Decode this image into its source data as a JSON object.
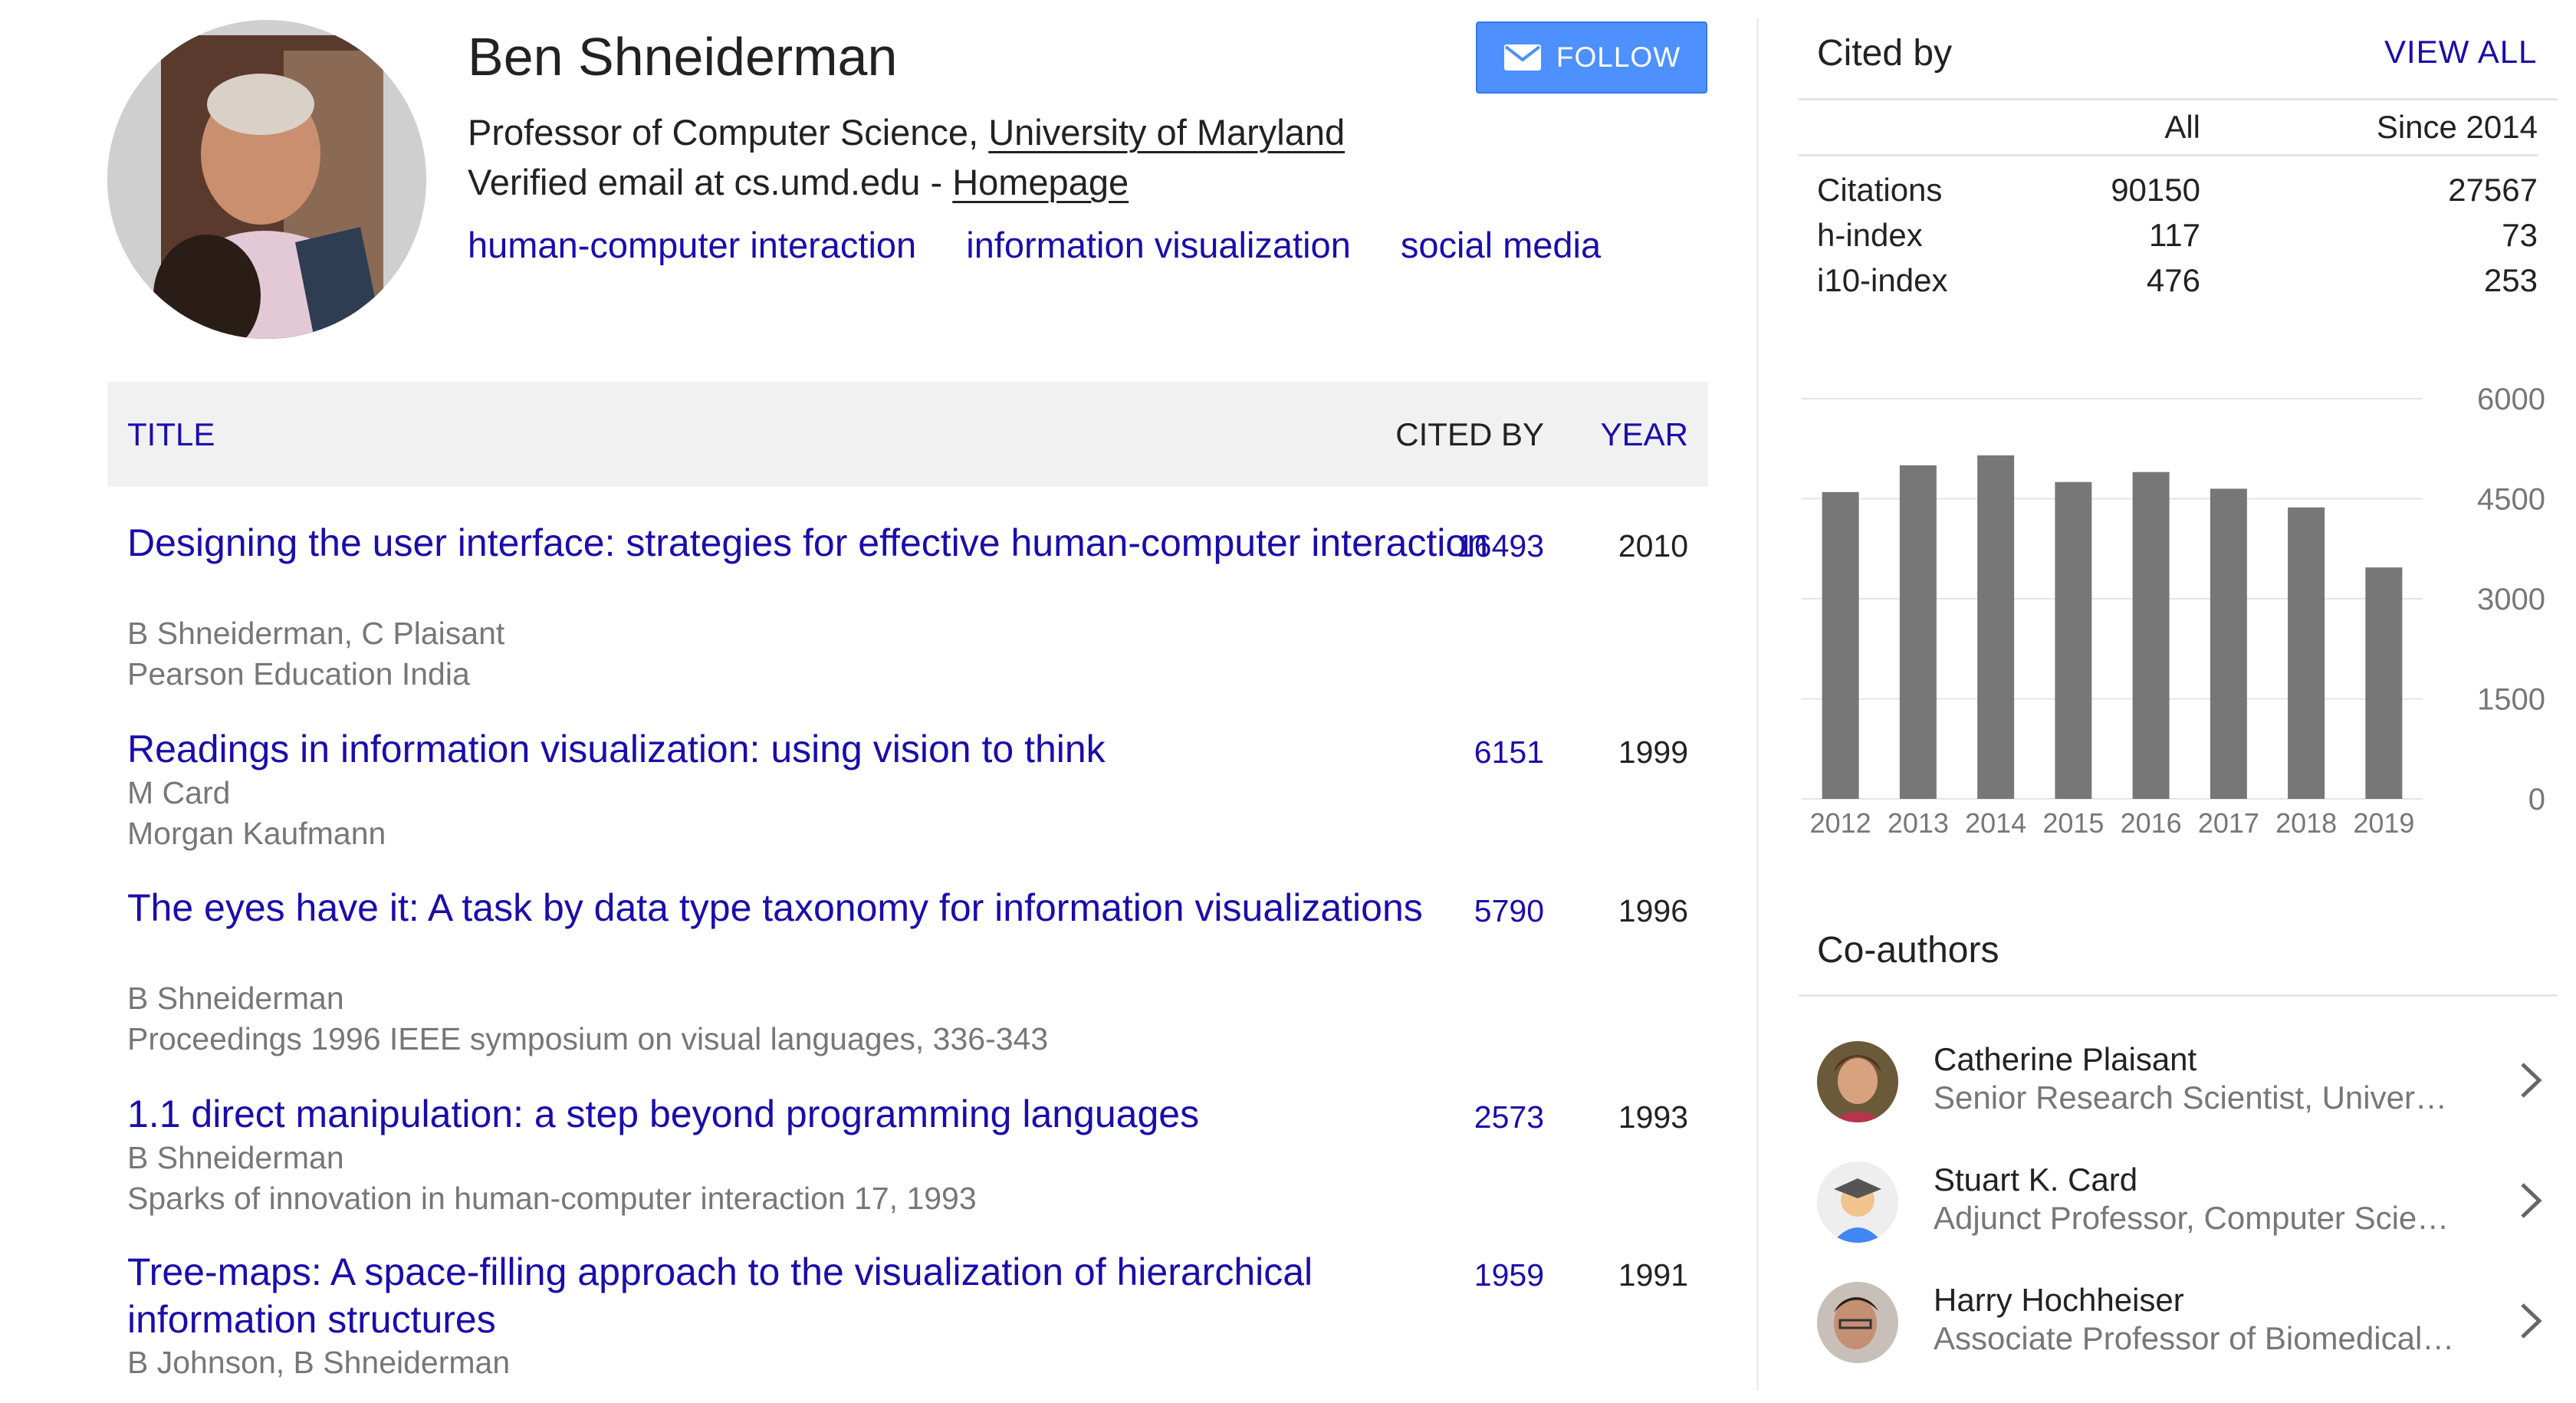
{
  "profile": {
    "name": "Ben Shneiderman",
    "position": "Professor of Computer Science, ",
    "affiliation": "University of Maryland",
    "email_text": "Verified email at cs.umd.edu - ",
    "homepage": "Homepage",
    "interests": [
      "human-computer interaction",
      "information visualization",
      "social media"
    ],
    "follow_label": "FOLLOW",
    "avatar_icon": "profile-photo",
    "follow_icon": "envelope-icon"
  },
  "table": {
    "title_header": "TITLE",
    "cited_header": "CITED BY",
    "year_header": "YEAR"
  },
  "publications": [
    {
      "title": "Designing the user interface: strategies for effective human-computer interaction",
      "authors": "B Shneiderman, C Plaisant",
      "venue": "Pearson Education India",
      "cited_by": "16493",
      "year": "2010"
    },
    {
      "title": "Readings in information visualization: using vision to think",
      "authors": "M Card",
      "venue": "Morgan Kaufmann",
      "cited_by": "6151",
      "year": "1999"
    },
    {
      "title": "The eyes have it: A task by data type taxonomy for information visualizations",
      "authors": "B Shneiderman",
      "venue": "Proceedings 1996 IEEE symposium on visual languages, 336-343",
      "cited_by": "5790",
      "year": "1996"
    },
    {
      "title": "1.1 direct manipulation: a step beyond programming languages",
      "authors": "B Shneiderman",
      "venue": "Sparks of innovation in human-computer interaction 17, 1993",
      "cited_by": "2573",
      "year": "1993"
    },
    {
      "title": "Tree-maps: A space-filling approach to the visualization of hierarchical information structures",
      "authors": "B Johnson, B Shneiderman",
      "venue": "",
      "cited_by": "1959",
      "year": "1991"
    }
  ],
  "cited_by": {
    "title": "Cited by",
    "view_all": "VIEW ALL",
    "col_all": "All",
    "col_since": "Since 2014",
    "rows": [
      {
        "label": "Citations",
        "all": "90150",
        "since": "27567"
      },
      {
        "label": "h-index",
        "all": "117",
        "since": "73"
      },
      {
        "label": "i10-index",
        "all": "476",
        "since": "253"
      }
    ]
  },
  "chart_data": {
    "type": "bar",
    "categories": [
      "2012",
      "2013",
      "2014",
      "2015",
      "2016",
      "2017",
      "2018",
      "2019"
    ],
    "values": [
      4600,
      5000,
      5150,
      4750,
      4900,
      4650,
      4370,
      3470
    ],
    "y_ticks": [
      "6000",
      "4500",
      "3000",
      "1500",
      "0"
    ],
    "ylim": [
      0,
      6000
    ],
    "bar_color": "#777777",
    "grid": true,
    "title": "",
    "xlabel": "",
    "ylabel": ""
  },
  "coauthors": {
    "title": "Co-authors",
    "items": [
      {
        "name": "Catherine Plaisant",
        "affiliation": "Senior Research Scientist, University of Maryland",
        "photo": "person-photo"
      },
      {
        "name": "Stuart K. Card",
        "affiliation": "Adjunct Professor, Computer Science",
        "photo": "default-scholar-avatar"
      },
      {
        "name": "Harry Hochheiser",
        "affiliation": "Associate Professor of Biomedical Informatics",
        "photo": "person-photo"
      }
    ]
  },
  "colors": {
    "link": "#1a0dab",
    "follow_button": "#4d90fe",
    "muted_text": "#777777",
    "header_bg": "#f1f1f1"
  }
}
